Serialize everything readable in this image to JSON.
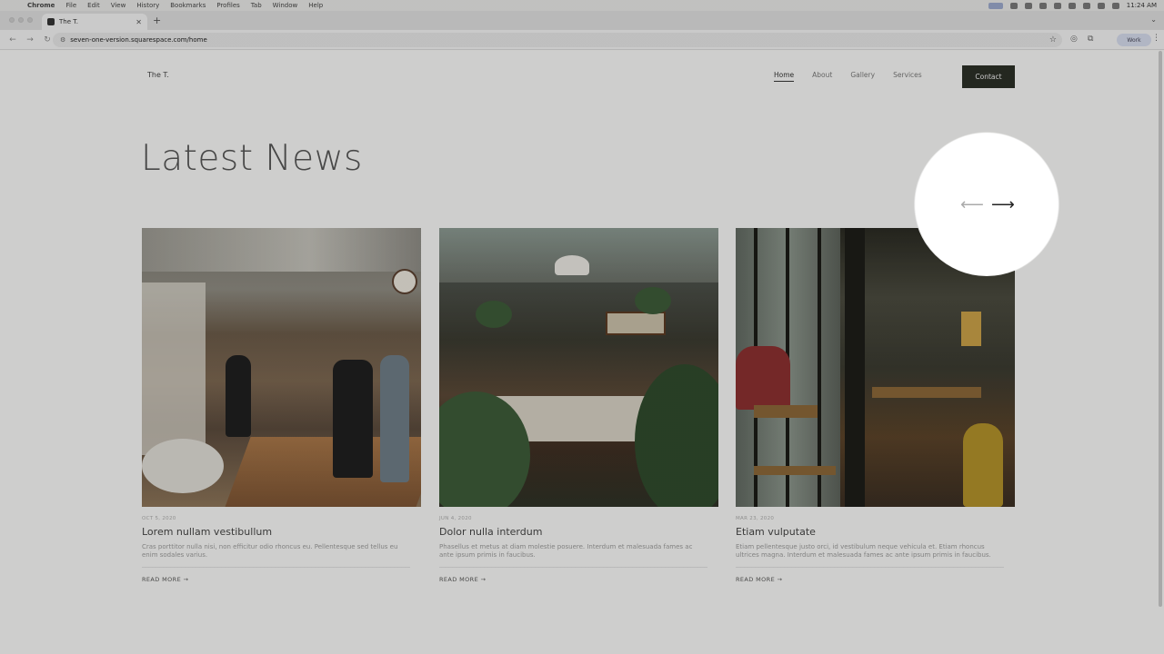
{
  "menubar": {
    "items": [
      "Chrome",
      "File",
      "Edit",
      "View",
      "History",
      "Bookmarks",
      "Profiles",
      "Tab",
      "Window",
      "Help"
    ],
    "time": "11:24 AM"
  },
  "browser": {
    "tab_title": "The T.",
    "url": "seven-one-version.squarespace.com/home",
    "profile_label": "Work"
  },
  "site": {
    "title": "The T.",
    "nav": [
      "Home",
      "About",
      "Gallery",
      "Services"
    ],
    "active_nav": "Home",
    "contact_label": "Contact"
  },
  "section": {
    "heading": "Latest News",
    "prev_arrow": "⟵",
    "next_arrow": "⟶"
  },
  "posts": [
    {
      "date": "OCT 5, 2020",
      "title": "Lorem nullam vestibullum",
      "excerpt": "Cras porttitor nulla nisi, non efficitur odio rhoncus eu. Pellentesque sed tellus eu enim sodales varius.",
      "read_more": "READ MORE →"
    },
    {
      "date": "JUN 4, 2020",
      "title": "Dolor nulla interdum",
      "excerpt": "Phasellus et metus at diam molestie posuere. Interdum et malesuada fames ac ante ipsum primis in faucibus.",
      "read_more": "READ MORE →"
    },
    {
      "date": "MAR 23, 2020",
      "title": "Etiam vulputate",
      "excerpt": "Etiam pellentesque justo orci, id vestibulum neque vehicula et. Etiam rhoncus ultrices magna. Interdum et malesuada fames ac ante ipsum primis in faucibus.",
      "read_more": "READ MORE →"
    }
  ]
}
